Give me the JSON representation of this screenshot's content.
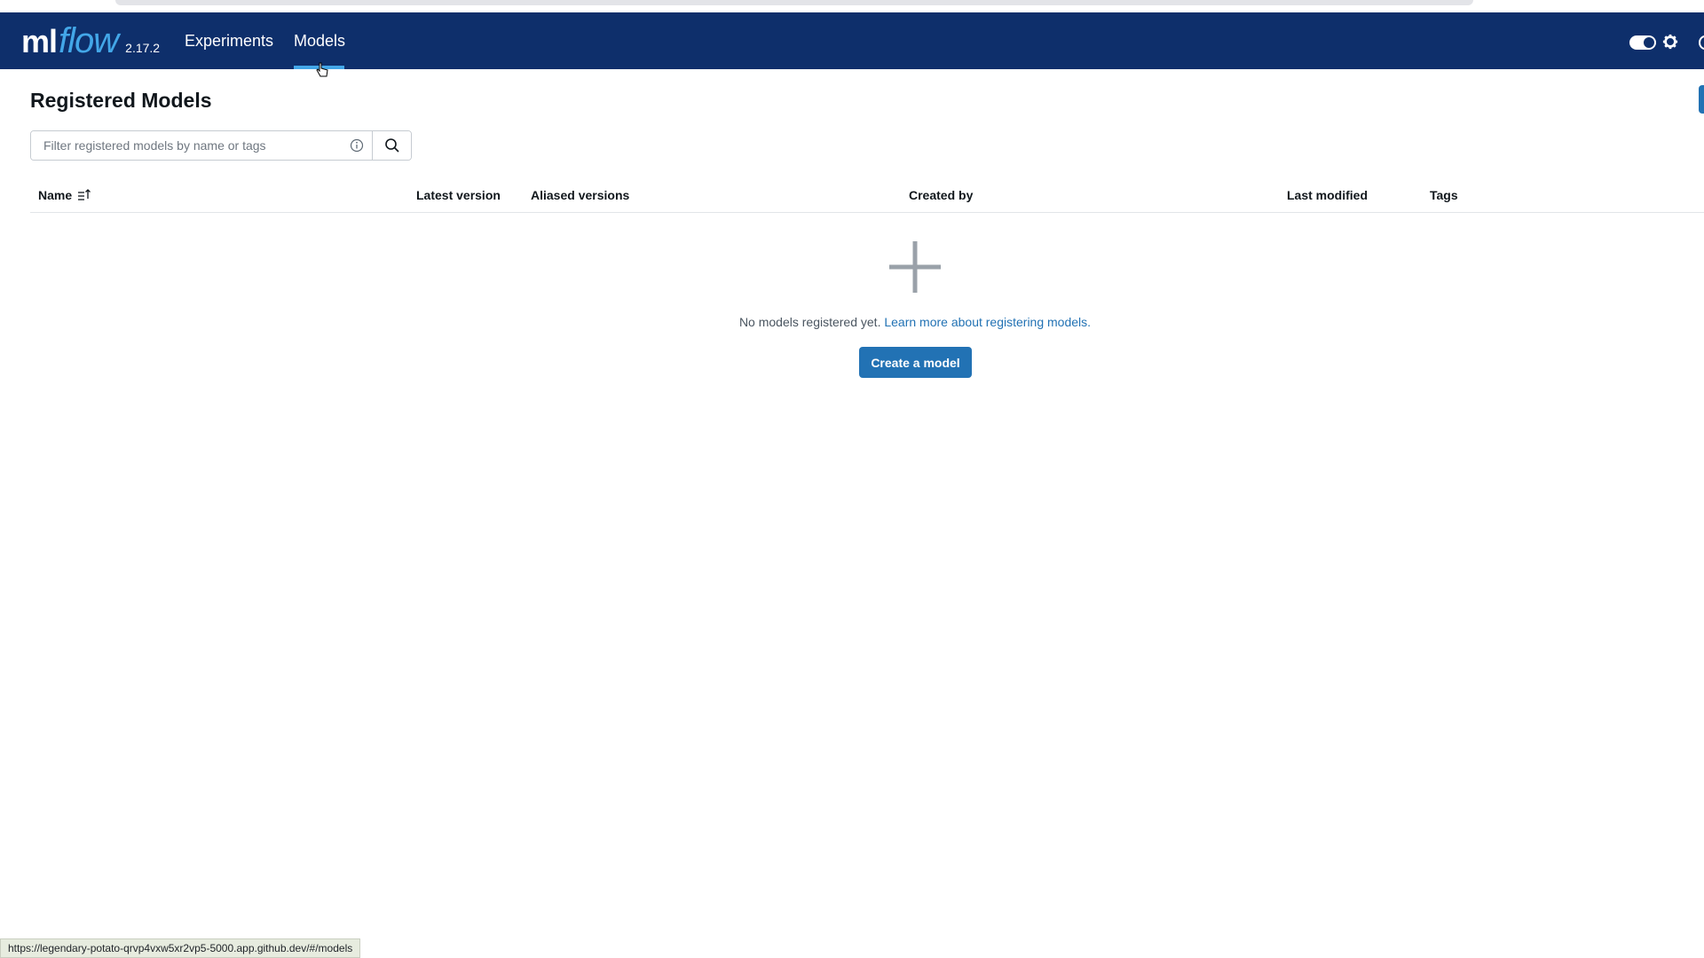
{
  "app": {
    "logo_ml": "ml",
    "logo_flow": "flow",
    "version": "2.17.2"
  },
  "nav": {
    "items": [
      {
        "label": "Experiments",
        "active": false
      },
      {
        "label": "Models",
        "active": true
      }
    ]
  },
  "colors": {
    "header_bg": "#0e2f6b",
    "accent": "#43a7e8",
    "primary_button": "#2272b4"
  },
  "page": {
    "title": "Registered Models"
  },
  "search": {
    "placeholder": "Filter registered models by name or tags",
    "value": ""
  },
  "table": {
    "columns": [
      "Name",
      "Latest version",
      "Aliased versions",
      "Created by",
      "Last modified",
      "Tags"
    ],
    "sort_column": "Name",
    "rows": []
  },
  "empty_state": {
    "icon": "plus-icon",
    "message": "No models registered yet.",
    "link_text": "Learn more about registering models.",
    "button_label": "Create a model"
  },
  "status_bar": {
    "url": "https://legendary-potato-qrvp4vxw5xr2vp5-5000.app.github.dev/#/models"
  }
}
